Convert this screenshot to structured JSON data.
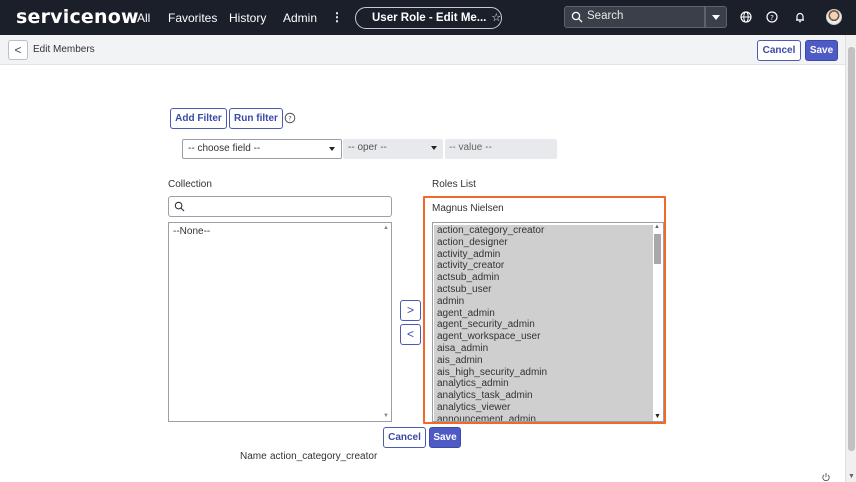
{
  "nav": {
    "logo": "servicenow",
    "links": [
      "All",
      "Favorites",
      "History",
      "Admin"
    ],
    "more": "⋮",
    "tab_title": "User Role - Edit Me...",
    "search_placeholder": "Search"
  },
  "header": {
    "back": "<",
    "title": "Edit Members",
    "cancel": "Cancel",
    "save": "Save"
  },
  "filter": {
    "add_filter": "Add Filter",
    "run_filter": "Run filter",
    "field": "-- choose field --",
    "oper": "-- oper --",
    "value": "-- value --"
  },
  "collection": {
    "label": "Collection",
    "items": [
      "--None--"
    ]
  },
  "move": {
    "add": ">",
    "remove": "<"
  },
  "roles": {
    "label": "Roles List",
    "user": "Magnus Nielsen",
    "items": [
      "action_category_creator",
      "action_designer",
      "activity_admin",
      "activity_creator",
      "actsub_admin",
      "actsub_user",
      "admin",
      "agent_admin",
      "agent_security_admin",
      "agent_workspace_user",
      "aisa_admin",
      "ais_admin",
      "ais_high_security_admin",
      "analytics_admin",
      "analytics_task_admin",
      "analytics_viewer",
      "announcement_admin"
    ]
  },
  "footer": {
    "cancel": "Cancel",
    "save": "Save",
    "name_label": "Name",
    "name_value": "action_category_creator"
  }
}
